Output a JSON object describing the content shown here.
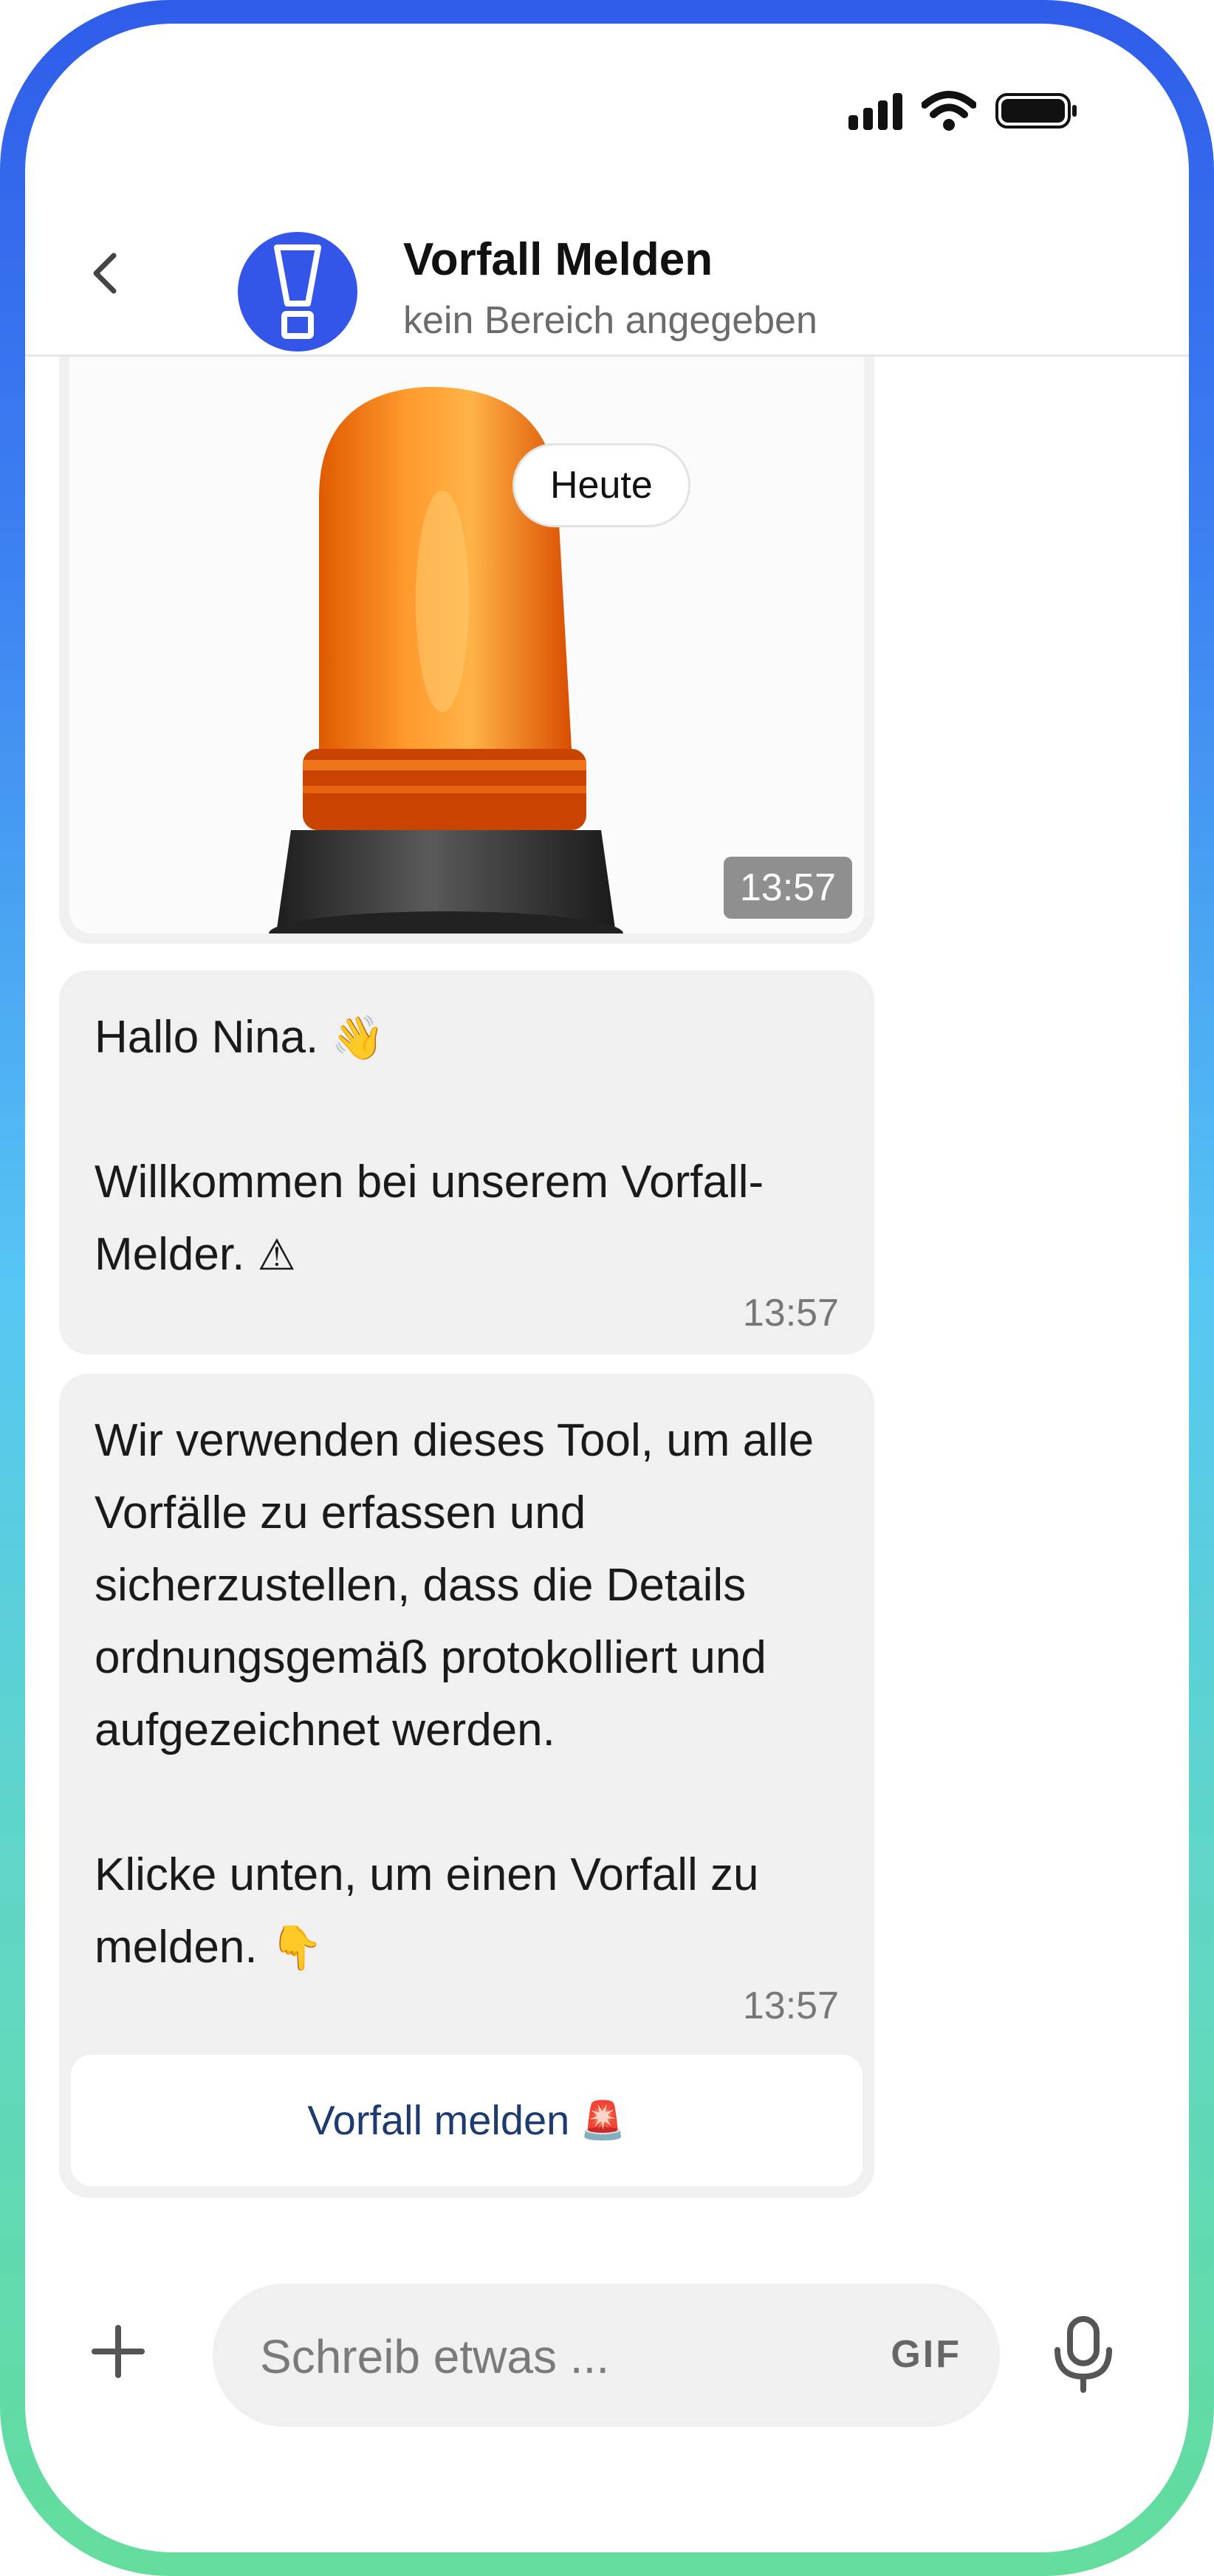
{
  "header": {
    "title": "Vorfall Melden",
    "subtitle": "kein Bereich angegeben",
    "back_icon": "chevron-left-icon",
    "avatar_icon": "exclamation-icon",
    "avatar_color": "#3456e8"
  },
  "status_bar": {
    "icons": [
      "signal-icon",
      "wifi-icon",
      "battery-icon"
    ]
  },
  "chat": {
    "day_label": "Heute",
    "messages": [
      {
        "type": "image",
        "image": "orange-warning-beacon",
        "time": "13:57"
      },
      {
        "type": "text",
        "greeting": "Hallo Nina.",
        "greeting_emoji": "👋",
        "line2": "Willkommen bei unserem Vorfall-Melder.",
        "line2_emoji": "⚠",
        "time": "13:57"
      },
      {
        "type": "text",
        "paragraph1": "Wir verwenden dieses Tool, um alle Vorfälle zu erfassen und sicherzustellen, dass die Details ordnungsgemäß protokolliert und aufgezeichnet werden.",
        "paragraph2": "Klicke unten, um einen Vorfall zu melden.",
        "paragraph2_emoji": "👇",
        "time": "13:57",
        "button_label": "Vorfall melden",
        "button_emoji": "🚨"
      }
    ]
  },
  "composer": {
    "placeholder": "Schreib etwas ...",
    "gif_label": "GIF",
    "plus_icon": "plus-icon",
    "mic_icon": "microphone-icon"
  },
  "colors": {
    "frame_top": "#2f5ce9",
    "frame_bottom": "#63dc9c",
    "bubble": "#f0f0f0",
    "button_text": "#1e3a6e"
  }
}
